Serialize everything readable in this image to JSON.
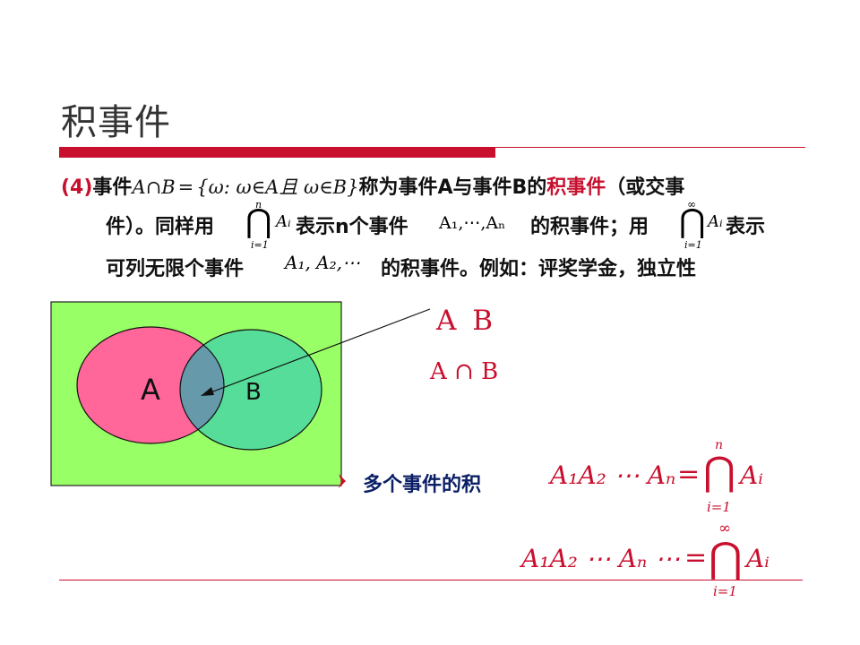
{
  "slide": {
    "title": "积事件"
  },
  "definition": {
    "marker": "(4)",
    "line1_lead": "事件",
    "formula_lhs": "A∩B",
    "formula_eq": "=",
    "formula_set": "{ω: ω∈A且 ω∈B}",
    "line1_mid": "称为事件A与事件B的",
    "term": "积事件",
    "line1_tail": "（或交事",
    "line2_lead": "件）。同样用",
    "line2_mid": "表示n个事件",
    "line2_seq": "A₁,⋯,Aₙ",
    "line2_tail": "的积事件；用",
    "line2_end": "表示",
    "line3_lead": "可列无限个事件",
    "line3_seq": "A₁, A₂,⋯",
    "line3_tail": "的积事件。例如：评奖学金，独立性"
  },
  "cap_n": {
    "upper": "n",
    "symbol": "⋂",
    "body": "Aᵢ",
    "lower": "i=1"
  },
  "cap_inf": {
    "upper": "∞",
    "symbol": "⋂",
    "body": "Aᵢ",
    "lower": "i=1"
  },
  "venn": {
    "label_a": "A",
    "label_b": "B",
    "colors": {
      "background": "#99ff66",
      "set_a": "#ff6699",
      "set_b": "#55dd99",
      "intersection": "#6699aa"
    }
  },
  "annotations": {
    "ab_notation": "A B",
    "cap_notation": "A ∩ B"
  },
  "multi": {
    "bullet_label": "多个事件的积",
    "eq1_lhs": "A₁A₂ ⋯ Aₙ",
    "eq1_eq": "=",
    "eq1_upper": "n",
    "eq1_body": "Aᵢ",
    "eq1_lower": "i=1",
    "eq2_lhs": "A₁A₂ ⋯ Aₙ ⋯",
    "eq2_eq": "=",
    "eq2_upper": "∞",
    "eq2_body": "Aᵢ",
    "eq2_lower": "i=1"
  },
  "colors": {
    "accent": "#c8102e",
    "text": "#111111",
    "bullet_text": "#0b1f66"
  }
}
